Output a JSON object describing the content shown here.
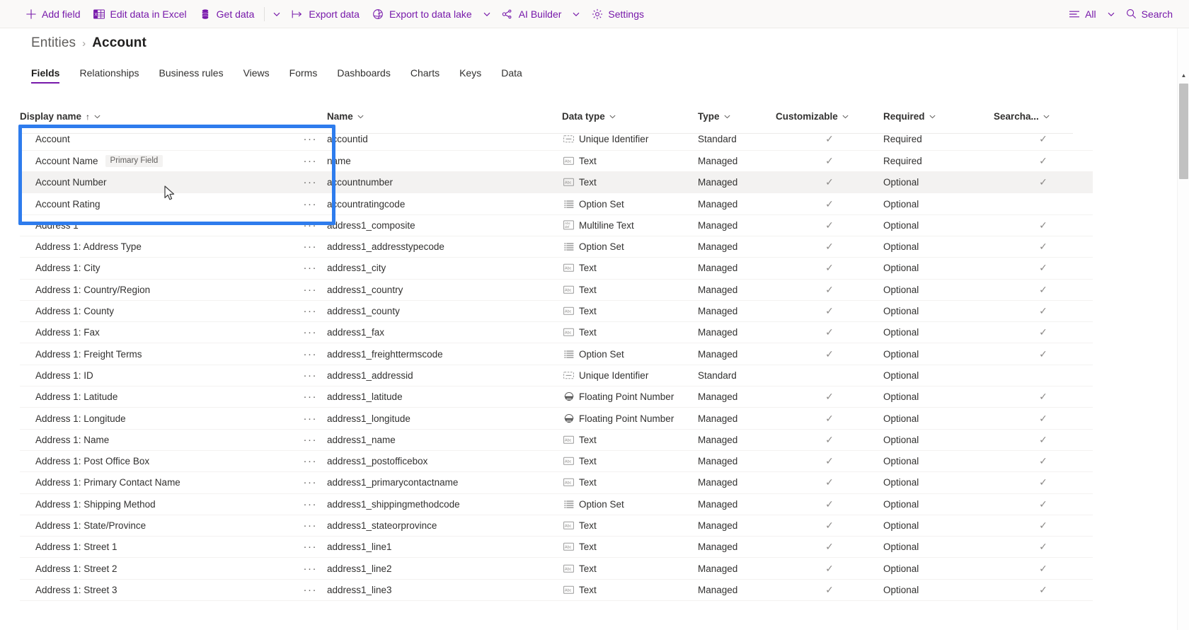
{
  "commandbar": {
    "buttons": [
      {
        "label": "Add field",
        "icon": "plus-icon"
      },
      {
        "label": "Edit data in Excel",
        "icon": "excel-icon"
      },
      {
        "label": "Get data",
        "icon": "database-icon"
      }
    ],
    "overflow_chevron": "chevron-down-icon",
    "buttons2": [
      {
        "label": "Export data",
        "icon": "export-icon",
        "has_chevron": false
      },
      {
        "label": "Export to data lake",
        "icon": "datalake-icon",
        "has_chevron": true
      },
      {
        "label": "AI Builder",
        "icon": "ai-builder-icon",
        "has_chevron": true
      },
      {
        "label": "Settings",
        "icon": "gear-icon",
        "has_chevron": false
      }
    ],
    "filter": {
      "label": "All",
      "icon": "filter-icon",
      "chevron": "chevron-down-icon"
    },
    "search": {
      "label": "Search",
      "icon": "search-icon"
    },
    "accent_color": "#7719aa"
  },
  "breadcrumb": {
    "parent": "Entities",
    "separator": "›",
    "current": "Account"
  },
  "tabs": [
    {
      "label": "Fields",
      "active": true
    },
    {
      "label": "Relationships",
      "active": false
    },
    {
      "label": "Business rules",
      "active": false
    },
    {
      "label": "Views",
      "active": false
    },
    {
      "label": "Forms",
      "active": false
    },
    {
      "label": "Dashboards",
      "active": false
    },
    {
      "label": "Charts",
      "active": false
    },
    {
      "label": "Keys",
      "active": false
    },
    {
      "label": "Data",
      "active": false
    }
  ],
  "table": {
    "columns": [
      {
        "label": "Display name",
        "sorted": true,
        "sort_arrow": "↑",
        "chevron": true
      },
      {
        "label": "Name",
        "sorted": false,
        "chevron": true
      },
      {
        "label": "Data type",
        "sorted": false,
        "chevron": true
      },
      {
        "label": "Type",
        "sorted": false,
        "chevron": true
      },
      {
        "label": "Customizable",
        "sorted": false,
        "chevron": true
      },
      {
        "label": "Required",
        "sorted": false,
        "chevron": true
      },
      {
        "label": "Searcha...",
        "sorted": false,
        "chevron": true
      }
    ],
    "row_menu_glyph": "···",
    "checkmark_glyph": "✓",
    "selection_color": "#2e7ced",
    "rows": [
      {
        "display_name": "Account",
        "badge": "",
        "name": "accountid",
        "data_type": "Unique Identifier",
        "data_type_icon": "unique-identifier-icon",
        "type": "Standard",
        "customizable": true,
        "required": "Required",
        "searchable": true
      },
      {
        "display_name": "Account Name",
        "badge": "Primary Field",
        "name": "name",
        "data_type": "Text",
        "data_type_icon": "text-icon",
        "type": "Managed",
        "customizable": true,
        "required": "Required",
        "searchable": true
      },
      {
        "display_name": "Account Number",
        "badge": "",
        "name": "accountnumber",
        "data_type": "Text",
        "data_type_icon": "text-icon",
        "type": "Managed",
        "customizable": true,
        "required": "Optional",
        "searchable": true,
        "hovered": true
      },
      {
        "display_name": "Account Rating",
        "badge": "",
        "name": "accountratingcode",
        "data_type": "Option Set",
        "data_type_icon": "option-set-icon",
        "type": "Managed",
        "customizable": true,
        "required": "Optional",
        "searchable": false
      },
      {
        "display_name": "Address 1",
        "badge": "",
        "name": "address1_composite",
        "data_type": "Multiline Text",
        "data_type_icon": "multiline-text-icon",
        "type": "Managed",
        "customizable": true,
        "required": "Optional",
        "searchable": true
      },
      {
        "display_name": "Address 1: Address Type",
        "badge": "",
        "name": "address1_addresstypecode",
        "data_type": "Option Set",
        "data_type_icon": "option-set-icon",
        "type": "Managed",
        "customizable": true,
        "required": "Optional",
        "searchable": true
      },
      {
        "display_name": "Address 1: City",
        "badge": "",
        "name": "address1_city",
        "data_type": "Text",
        "data_type_icon": "text-icon",
        "type": "Managed",
        "customizable": true,
        "required": "Optional",
        "searchable": true
      },
      {
        "display_name": "Address 1: Country/Region",
        "badge": "",
        "name": "address1_country",
        "data_type": "Text",
        "data_type_icon": "text-icon",
        "type": "Managed",
        "customizable": true,
        "required": "Optional",
        "searchable": true
      },
      {
        "display_name": "Address 1: County",
        "badge": "",
        "name": "address1_county",
        "data_type": "Text",
        "data_type_icon": "text-icon",
        "type": "Managed",
        "customizable": true,
        "required": "Optional",
        "searchable": true
      },
      {
        "display_name": "Address 1: Fax",
        "badge": "",
        "name": "address1_fax",
        "data_type": "Text",
        "data_type_icon": "text-icon",
        "type": "Managed",
        "customizable": true,
        "required": "Optional",
        "searchable": true
      },
      {
        "display_name": "Address 1: Freight Terms",
        "badge": "",
        "name": "address1_freighttermscode",
        "data_type": "Option Set",
        "data_type_icon": "option-set-icon",
        "type": "Managed",
        "customizable": true,
        "required": "Optional",
        "searchable": true
      },
      {
        "display_name": "Address 1: ID",
        "badge": "",
        "name": "address1_addressid",
        "data_type": "Unique Identifier",
        "data_type_icon": "unique-identifier-icon",
        "type": "Standard",
        "customizable": false,
        "required": "Optional",
        "searchable": false
      },
      {
        "display_name": "Address 1: Latitude",
        "badge": "",
        "name": "address1_latitude",
        "data_type": "Floating Point Number",
        "data_type_icon": "floating-point-icon",
        "type": "Managed",
        "customizable": true,
        "required": "Optional",
        "searchable": true
      },
      {
        "display_name": "Address 1: Longitude",
        "badge": "",
        "name": "address1_longitude",
        "data_type": "Floating Point Number",
        "data_type_icon": "floating-point-icon",
        "type": "Managed",
        "customizable": true,
        "required": "Optional",
        "searchable": true
      },
      {
        "display_name": "Address 1: Name",
        "badge": "",
        "name": "address1_name",
        "data_type": "Text",
        "data_type_icon": "text-icon",
        "type": "Managed",
        "customizable": true,
        "required": "Optional",
        "searchable": true
      },
      {
        "display_name": "Address 1: Post Office Box",
        "badge": "",
        "name": "address1_postofficebox",
        "data_type": "Text",
        "data_type_icon": "text-icon",
        "type": "Managed",
        "customizable": true,
        "required": "Optional",
        "searchable": true
      },
      {
        "display_name": "Address 1: Primary Contact Name",
        "badge": "",
        "name": "address1_primarycontactname",
        "data_type": "Text",
        "data_type_icon": "text-icon",
        "type": "Managed",
        "customizable": true,
        "required": "Optional",
        "searchable": true
      },
      {
        "display_name": "Address 1: Shipping Method",
        "badge": "",
        "name": "address1_shippingmethodcode",
        "data_type": "Option Set",
        "data_type_icon": "option-set-icon",
        "type": "Managed",
        "customizable": true,
        "required": "Optional",
        "searchable": true
      },
      {
        "display_name": "Address 1: State/Province",
        "badge": "",
        "name": "address1_stateorprovince",
        "data_type": "Text",
        "data_type_icon": "text-icon",
        "type": "Managed",
        "customizable": true,
        "required": "Optional",
        "searchable": true
      },
      {
        "display_name": "Address 1: Street 1",
        "badge": "",
        "name": "address1_line1",
        "data_type": "Text",
        "data_type_icon": "text-icon",
        "type": "Managed",
        "customizable": true,
        "required": "Optional",
        "searchable": true
      },
      {
        "display_name": "Address 1: Street 2",
        "badge": "",
        "name": "address1_line2",
        "data_type": "Text",
        "data_type_icon": "text-icon",
        "type": "Managed",
        "customizable": true,
        "required": "Optional",
        "searchable": true
      },
      {
        "display_name": "Address 1: Street 3",
        "badge": "",
        "name": "address1_line3",
        "data_type": "Text",
        "data_type_icon": "text-icon",
        "type": "Managed",
        "customizable": true,
        "required": "Optional",
        "searchable": true
      }
    ]
  },
  "scrollbar": {
    "up_arrow": "▲",
    "down_arrow": "▼"
  }
}
